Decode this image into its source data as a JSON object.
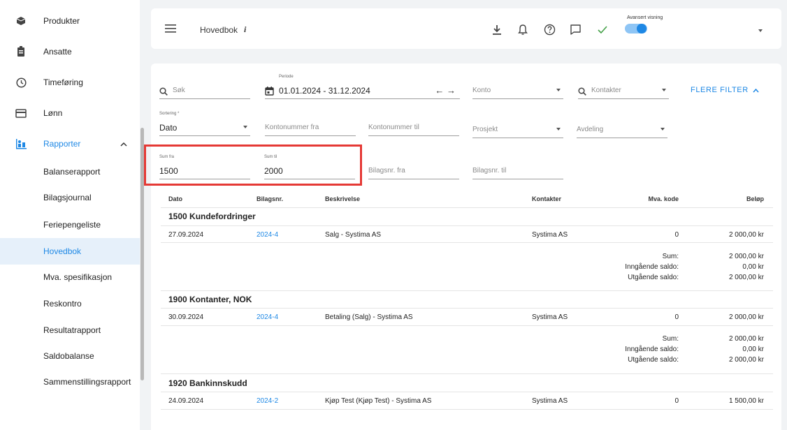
{
  "sidebar": {
    "items": [
      {
        "label": "Produkter",
        "icon": "box-icon"
      },
      {
        "label": "Ansatte",
        "icon": "employee-badge-icon"
      },
      {
        "label": "Timeføring",
        "icon": "clock-icon"
      },
      {
        "label": "Lønn",
        "icon": "card-icon"
      },
      {
        "label": "Rapporter",
        "icon": "report-icon"
      }
    ],
    "sub_items": [
      "Balanserapport",
      "Bilagsjournal",
      "Feriepengeliste",
      "Hovedbok",
      "Mva. spesifikasjon",
      "Reskontro",
      "Resultatrapport",
      "Saldobalanse",
      "Sammenstillingsrapport"
    ],
    "active": "Hovedbok"
  },
  "topbar": {
    "title": "Hovedbok",
    "info": "i",
    "advanced_label": "Avansert visning",
    "advanced_on": true
  },
  "filters": {
    "search_placeholder": "Søk",
    "period_label": "Periode",
    "period_value": "01.01.2024 - 31.12.2024",
    "period_arrows": "←  →",
    "konto_placeholder": "Konto",
    "kontakter_placeholder": "Kontakter",
    "more_filter": "FLERE FILTER",
    "sorting_label": "Sortering *",
    "sorting_value": "Dato",
    "kontonr_fra": "Kontonummer fra",
    "kontonr_til": "Kontonummer til",
    "prosjekt": "Prosjekt",
    "avdeling": "Avdeling",
    "sum_fra_label": "Sum fra",
    "sum_fra_value": "1500",
    "sum_til_label": "Sum til",
    "sum_til_value": "2000",
    "bilagsnr_fra": "Bilagsnr. fra",
    "bilagsnr_til": "Bilagsnr. til"
  },
  "table": {
    "headers": {
      "dato": "Dato",
      "bilagsnr": "Bilagsnr.",
      "beskrivelse": "Beskrivelse",
      "kontakter": "Kontakter",
      "mva": "Mva. kode",
      "belop": "Beløp"
    },
    "groups": [
      {
        "title": "1500 Kundefordringer",
        "row": {
          "dato": "27.09.2024",
          "bilag": "2024-4",
          "beskrivelse": "Salg - Systima AS",
          "kontakt": "Systima AS",
          "mva": "0",
          "belop": "2 000,00 kr"
        },
        "sum": "2 000,00 kr",
        "inngaende": "0,00 kr",
        "utgaende": "2 000,00 kr"
      },
      {
        "title": "1900 Kontanter, NOK",
        "row": {
          "dato": "30.09.2024",
          "bilag": "2024-4",
          "beskrivelse": "Betaling (Salg) - Systima AS",
          "kontakt": "Systima AS",
          "mva": "0",
          "belop": "2 000,00 kr"
        },
        "sum": "2 000,00 kr",
        "inngaende": "0,00 kr",
        "utgaende": "2 000,00 kr"
      },
      {
        "title": "1920 Bankinnskudd",
        "row": {
          "dato": "24.09.2024",
          "bilag": "2024-2",
          "beskrivelse": "Kjøp Test (Kjøp Test) - Systima AS",
          "kontakt": "Systima AS",
          "mva": "0",
          "belop": "1 500,00 kr"
        }
      }
    ],
    "sum_label": "Sum:",
    "inngaende_label": "Inngående saldo:",
    "utgaende_label": "Utgående saldo:"
  }
}
